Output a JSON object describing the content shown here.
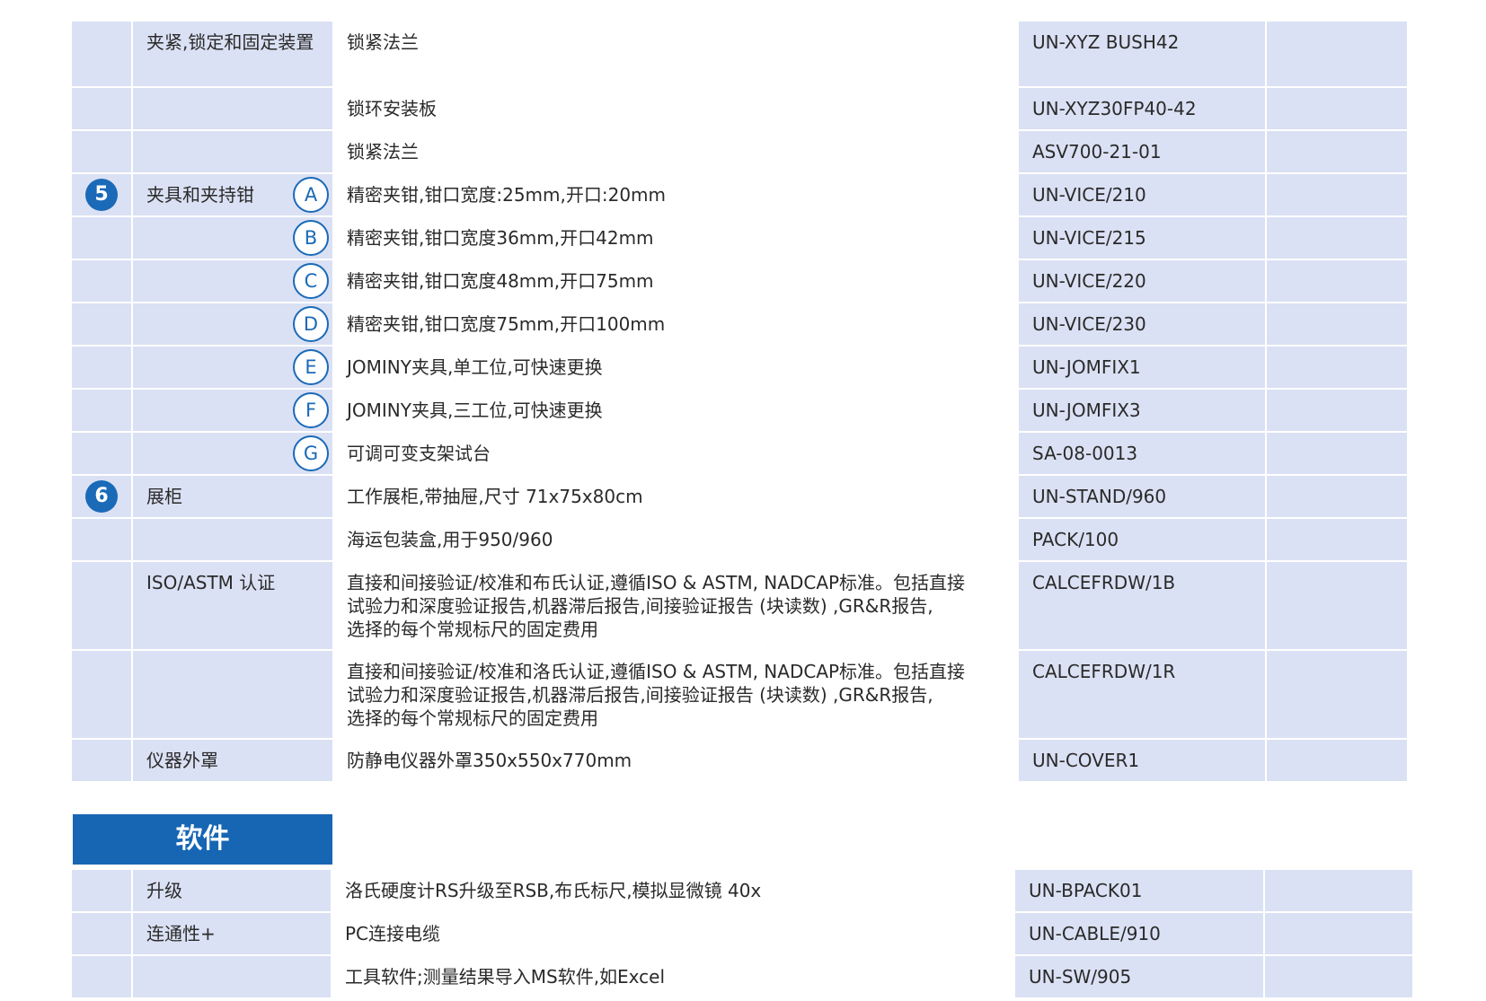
{
  "accent_color": "#1a6ab8",
  "hardware_rows": [
    {
      "number": "",
      "category": [
        "夹紧,",
        "锁定和固定装置"
      ],
      "marker": "",
      "description": [
        "锁紧法兰"
      ],
      "code": "UN-XYZ BUSH42"
    },
    {
      "number": "",
      "category": [],
      "marker": "",
      "description": [
        "锁环安装板"
      ],
      "code": "UN-XYZ30FP40-42"
    },
    {
      "number": "",
      "category": [],
      "marker": "",
      "description": [
        "锁紧法兰"
      ],
      "code": "ASV700-21-01"
    },
    {
      "number": "5",
      "category": [
        "夹具和夹持钳"
      ],
      "marker": "A",
      "description": [
        "精密夹钳,钳口宽度:25mm,开口:20mm"
      ],
      "code": "UN-VICE/210"
    },
    {
      "number": "",
      "category": [],
      "marker": "B",
      "description": [
        "精密夹钳,钳口宽度36mm,开口42mm"
      ],
      "code": "UN-VICE/215"
    },
    {
      "number": "",
      "category": [],
      "marker": "C",
      "description": [
        "精密夹钳,钳口宽度48mm,开口75mm"
      ],
      "code": "UN-VICE/220"
    },
    {
      "number": "",
      "category": [],
      "marker": "D",
      "description": [
        "精密夹钳,钳口宽度75mm,开口100mm"
      ],
      "code": "UN-VICE/230"
    },
    {
      "number": "",
      "category": [],
      "marker": "E",
      "description": [
        "JOMINY夹具,单工位,可快速更换"
      ],
      "code": "UN-JOMFIX1"
    },
    {
      "number": "",
      "category": [],
      "marker": "F",
      "description": [
        "JOMINY夹具,三工位,可快速更换"
      ],
      "code": "UN-JOMFIX3"
    },
    {
      "number": "",
      "category": [],
      "marker": "G",
      "description": [
        "可调可变支架试台"
      ],
      "code": "SA-08-0013"
    },
    {
      "number": "6",
      "category": [
        "展柜"
      ],
      "marker": "",
      "description": [
        "工作展柜,带抽屉,尺寸 71x75x80cm"
      ],
      "code": "UN-STAND/960"
    },
    {
      "number": "",
      "category": [],
      "marker": "",
      "description": [
        "海运包装盒,用于950/960"
      ],
      "code": "PACK/100"
    },
    {
      "number": "",
      "category": [
        "ISO/ASTM 认证"
      ],
      "marker": "",
      "description": [
        "直接和间接验证/校准和布氏认证,遵循ISO & ASTM, NADCAP标准。包括直接",
        "试验力和深度验证报告,机器滞后报告,间接验证报告 (块读数) ,GR&R报告,",
        "选择的每个常规标尺的固定费用"
      ],
      "code": "CALCEFRDW/1B"
    },
    {
      "number": "",
      "category": [],
      "marker": "",
      "description": [
        "直接和间接验证/校准和洛氏认证,遵循ISO & ASTM, NADCAP标准。包括直接",
        "试验力和深度验证报告,机器滞后报告,间接验证报告 (块读数) ,GR&R报告,",
        "选择的每个常规标尺的固定费用"
      ],
      "code": "CALCEFRDW/1R"
    },
    {
      "number": "",
      "category": [
        "仪器外罩"
      ],
      "marker": "",
      "description": [
        "防静电仪器外罩350x550x770mm"
      ],
      "code": "UN-COVER1"
    }
  ],
  "software": {
    "title": "软件",
    "rows": [
      {
        "category": [
          "升级"
        ],
        "description": [
          "洛氏硬度计RS升级至RSB,布氏标尺,模拟显微镜 40x"
        ],
        "code": "UN-BPACK01"
      },
      {
        "category": [
          "连通性+"
        ],
        "description": [
          "PC连接电缆"
        ],
        "code": "UN-CABLE/910"
      },
      {
        "category": [],
        "description": [
          "工具软件;测量结果导入MS软件,如Excel"
        ],
        "code": "UN-SW/905"
      }
    ]
  }
}
